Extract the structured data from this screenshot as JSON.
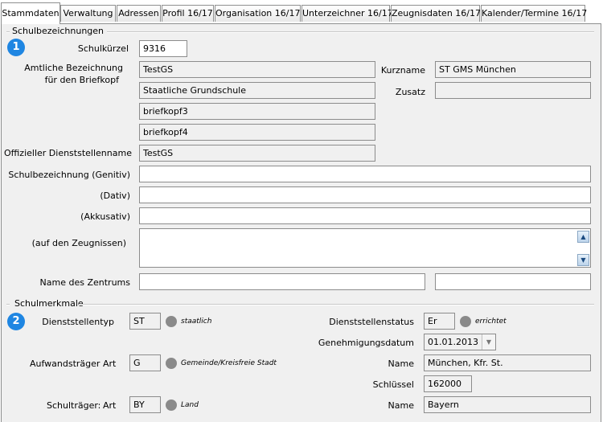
{
  "tabs": [
    {
      "label": "Stammdaten",
      "active": true
    },
    {
      "label": "Verwaltung"
    },
    {
      "label": "Adressen"
    },
    {
      "label": "Profil 16/17"
    },
    {
      "label": "Organisation 16/17"
    },
    {
      "label": "Unterzeichner 16/17"
    },
    {
      "label": "Zeugnisdaten 16/17"
    },
    {
      "label": "Kalender/Termine 16/17"
    }
  ],
  "schulbezeichnungen": {
    "title": "Schulbezeichnungen",
    "badge": "1",
    "schulkuerzel_label": "Schulkürzel",
    "schulkuerzel_value": "9316",
    "amtliche_label_1": "Amtliche Bezeichnung",
    "amtliche_label_2": "für den Briefkopf",
    "briefkopf1": "TestGS",
    "briefkopf2": "Staatliche Grundschule",
    "briefkopf3": "briefkopf3",
    "briefkopf4": "briefkopf4",
    "kurzname_label": "Kurzname",
    "kurzname_value": "ST GMS München",
    "zusatz_label": "Zusatz",
    "zusatz_value": "",
    "dienststellenname_label": "Offizieller Dienststellenname",
    "dienststellenname_value": "TestGS",
    "genitiv_label": "Schulbezeichnung (Genitiv)",
    "genitiv_value": "",
    "dativ_label": "(Dativ)",
    "dativ_value": "",
    "akkusativ_label": "(Akkusativ)",
    "akkusativ_value": "",
    "zeugnisse_label": "(auf den Zeugnissen)",
    "zeugnisse_value": "",
    "zentrum_label": "Name des Zentrums",
    "zentrum_value_1": "",
    "zentrum_value_2": ""
  },
  "schulmerkmale": {
    "title": "Schulmerkmale",
    "badge": "2",
    "dienststellentyp_label": "Dienststellentyp",
    "dienststellentyp_value": "ST",
    "dienststellentyp_hint": "staatlich",
    "dienststellenstatus_label": "Dienststellenstatus",
    "dienststellenstatus_value": "Er",
    "dienststellenstatus_hint": "errichtet",
    "genehmigung_label": "Genehmigungsdatum",
    "genehmigung_value": "01.01.2013",
    "aufwand_label": "Aufwandsträger",
    "aufwand_art_label": "Art",
    "aufwand_art_value": "G",
    "aufwand_hint": "Gemeinde/Kreisfreie Stadt",
    "aufwand_name_label": "Name",
    "aufwand_name_value": "München, Kfr. St.",
    "schluessel_label": "Schlüssel",
    "schluessel_value": "162000",
    "schultraeger_label": "Schulträger:",
    "schultraeger_art_label": "Art",
    "schultraeger_art_value": "BY",
    "schultraeger_hint": "Land",
    "schultraeger_name_label": "Name",
    "schultraeger_name_value": "Bayern"
  },
  "icons": {
    "scroll_up": "chevron-up-icon",
    "scroll_down": "chevron-down-icon",
    "info": "info-dot-icon",
    "dropdown": "chevron-down-icon"
  }
}
